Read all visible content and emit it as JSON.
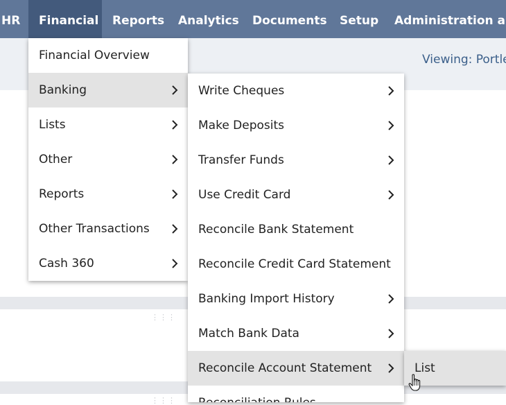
{
  "nav": {
    "items": [
      "HR",
      "Financial",
      "Reports",
      "Analytics",
      "Documents",
      "Setup",
      "Administration and"
    ],
    "active": "Financial"
  },
  "viewing_text": "Viewing: Portle",
  "menu_level1": [
    {
      "label": "Financial Overview",
      "submenu": false
    },
    {
      "label": "Banking",
      "submenu": true
    },
    {
      "label": "Lists",
      "submenu": true
    },
    {
      "label": "Other",
      "submenu": true
    },
    {
      "label": "Reports",
      "submenu": true
    },
    {
      "label": "Other Transactions",
      "submenu": true
    },
    {
      "label": "Cash 360",
      "submenu": true
    }
  ],
  "menu_level2": [
    {
      "label": "Write Cheques",
      "submenu": true
    },
    {
      "label": "Make Deposits",
      "submenu": true
    },
    {
      "label": "Transfer Funds",
      "submenu": true
    },
    {
      "label": "Use Credit Card",
      "submenu": true
    },
    {
      "label": "Reconcile Bank Statement",
      "submenu": false
    },
    {
      "label": "Reconcile Credit Card Statement",
      "submenu": false
    },
    {
      "label": "Banking Import History",
      "submenu": true
    },
    {
      "label": "Match Bank Data",
      "submenu": true
    },
    {
      "label": "Reconcile Account Statement",
      "submenu": true
    },
    {
      "label": "Reconciliation Rules",
      "submenu": false
    }
  ],
  "menu_level3": [
    {
      "label": "List",
      "submenu": false
    }
  ],
  "colors": {
    "nav_bg": "#607799",
    "nav_active": "#435a7c",
    "highlight": "#e3e3e3",
    "link": "#3b5f8a"
  },
  "icons": [
    "chevron-right-icon",
    "hand-cursor-icon",
    "drag-handle-icon"
  ]
}
